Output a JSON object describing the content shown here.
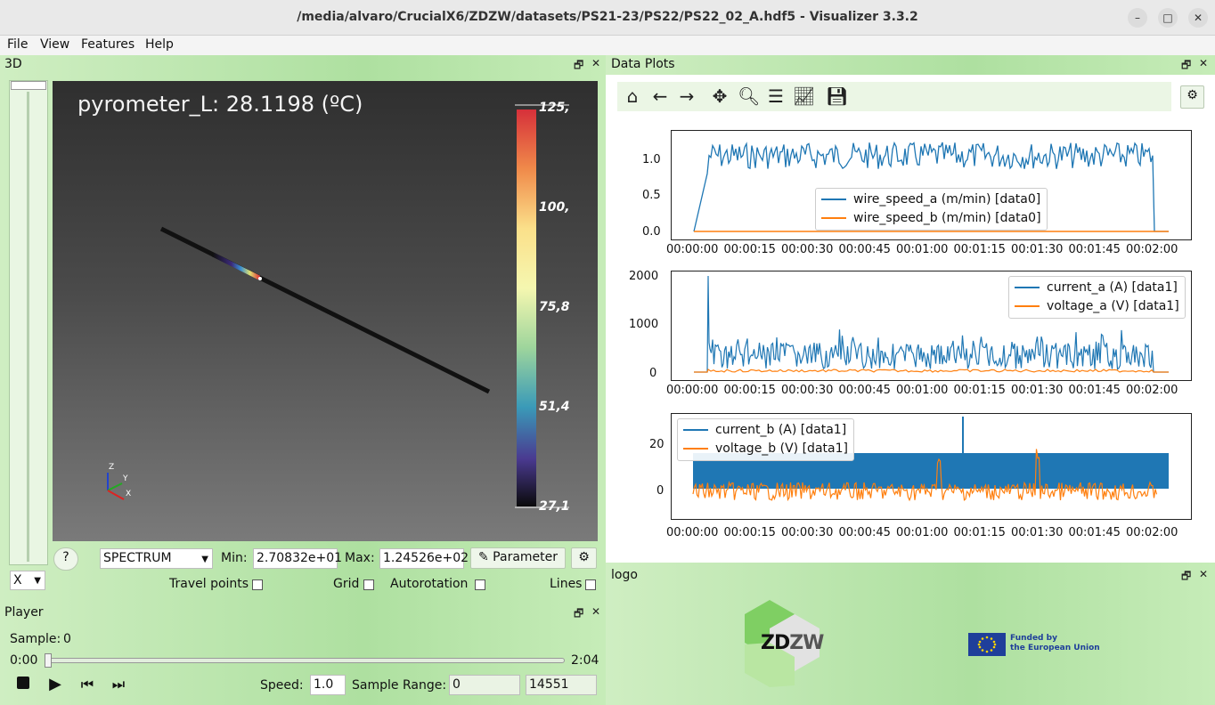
{
  "window": {
    "title": "/media/alvaro/CrucialX6/ZDZW/datasets/PS21-23/PS22/PS22_02_A.hdf5 - Visualizer 3.3.2",
    "minimize": "–",
    "maximize": "□",
    "close": "✕"
  },
  "menu": {
    "file": "File",
    "view": "View",
    "features": "Features",
    "help": "Help"
  },
  "dock3d": {
    "title": "3D",
    "overlay": "pyrometer_L: 28.1198 (ºC)",
    "colorbar_ticks": [
      "125,",
      "100,",
      "75,8",
      "51,4",
      "27,1"
    ],
    "axes": {
      "z": "Z",
      "y": "Y",
      "x": "X"
    },
    "axis_select": "X",
    "help_button": "?",
    "colormap": "SPECTRUM",
    "min_label": "Min:",
    "min_value": "2.70832e+01",
    "max_label": "Max:",
    "max_value": "1.24526e+02",
    "parameter_button": "Parameter",
    "travel_points": "Travel points",
    "grid": "Grid",
    "autorotation": "Autorotation",
    "lines": "Lines"
  },
  "player": {
    "title": "Player",
    "sample_label": "Sample:",
    "sample_value": "0",
    "time_start": "0:00",
    "time_end": "2:04",
    "speed_label": "Speed:",
    "speed_value": "1.0",
    "range_label": "Sample Range:",
    "range_start": "0",
    "range_end": "14551"
  },
  "plots": {
    "title": "Data Plots",
    "x_ticks": [
      "00:00:00",
      "00:00:15",
      "00:00:30",
      "00:00:45",
      "00:01:00",
      "00:01:15",
      "00:01:30",
      "00:01:45",
      "00:02:00"
    ],
    "p1": {
      "y_ticks": [
        "1.0",
        "0.5",
        "0.0"
      ],
      "legend": [
        "wire_speed_a (m/min) [data0]",
        "wire_speed_b (m/min) [data0]"
      ]
    },
    "p2": {
      "y_ticks": [
        "2000",
        "1000",
        "0"
      ],
      "legend": [
        "current_a (A) [data1]",
        "voltage_a (V) [data1]"
      ]
    },
    "p3": {
      "y_ticks": [
        "20",
        "0"
      ],
      "legend": [
        "current_b (A) [data1]",
        "voltage_b (V) [data1]"
      ]
    }
  },
  "logo": {
    "title": "logo",
    "zdzw_zd": "ZD",
    "zdzw_zw": "ZW",
    "eu_line1": "Funded by",
    "eu_line2": "the European Union"
  },
  "colors": {
    "blue": "#1f77b4",
    "orange": "#ff7f0e"
  },
  "chart_data": [
    {
      "type": "line",
      "x_range": [
        "00:00:00",
        "00:02:04"
      ],
      "ylim": [
        -0.1,
        1.35
      ],
      "series": [
        {
          "name": "wire_speed_a (m/min) [data0]",
          "summary": "0 until ~00:00:10, then ~1.05 fluctuating 0.85–1.3 until ~00:02:02, then 0"
        },
        {
          "name": "wire_speed_b (m/min) [data0]",
          "summary": "0 throughout"
        }
      ]
    },
    {
      "type": "line",
      "x_range": [
        "00:00:00",
        "00:02:04"
      ],
      "ylim": [
        -100,
        2100
      ],
      "series": [
        {
          "name": "current_a (A) [data1]",
          "summary": "spike ~2000 at ~00:00:10, then band 150–800 until ~00:02:02"
        },
        {
          "name": "voltage_a (V) [data1]",
          "summary": "~20–30 during welding"
        }
      ]
    },
    {
      "type": "line",
      "x_range": [
        "00:00:00",
        "00:02:04"
      ],
      "ylim": [
        -5,
        35
      ],
      "series": [
        {
          "name": "current_b (A) [data1]",
          "summary": "band 0–16, spike ~32 near 00:01:12"
        },
        {
          "name": "voltage_b (V) [data1]",
          "summary": "~0–5 with spikes ~8"
        }
      ]
    }
  ]
}
